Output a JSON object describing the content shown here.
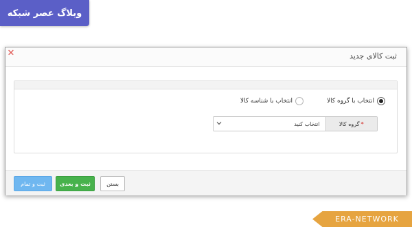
{
  "brand": {
    "label": "وبلاگ عصر شبکه"
  },
  "dialog": {
    "title": "ثبت کالای جدید",
    "close_icon": "close-icon",
    "radios": [
      {
        "label": "انتخاب با گروه کالا",
        "selected": true
      },
      {
        "label": "انتخاب با شناسه کالا",
        "selected": false
      }
    ],
    "field": {
      "label": "گروه کالا",
      "required_mark": "*",
      "select_value": "انتخاب کنید"
    },
    "buttons": {
      "finish": "ثبت و تمام",
      "next": "ثبت و بعدی",
      "close": "بستن"
    }
  },
  "watermark": {
    "text": "ERA-NETWORK"
  },
  "colors": {
    "brand_bg": "#5b5fc7",
    "close_red": "#e0534e",
    "finish_blue": "#6fb7f0",
    "next_green": "#47b24c",
    "watermark_orange": "#e6a440"
  }
}
